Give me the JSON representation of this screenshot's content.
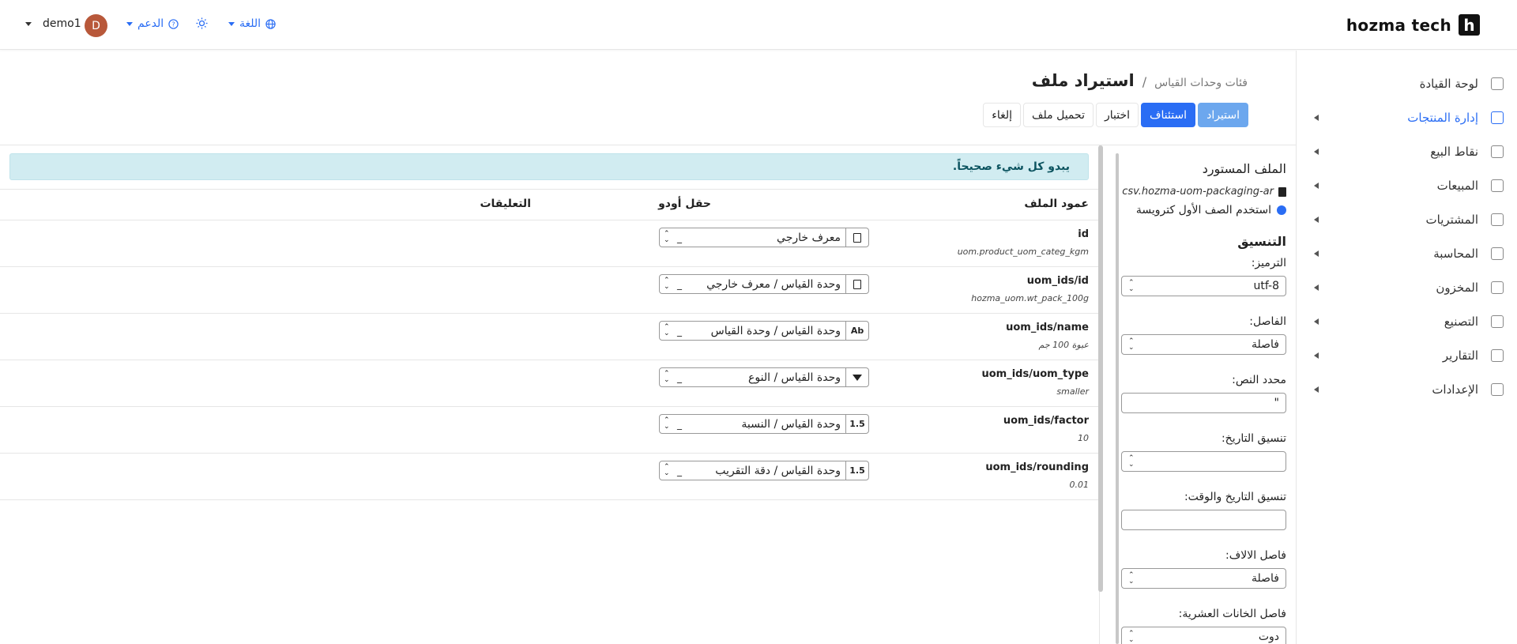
{
  "brand": {
    "name": "hozma tech",
    "mark": "h"
  },
  "topbar": {
    "user_name": "demo1",
    "avatar_letter": "D",
    "support_label": "الدعم",
    "language_label": "اللغة"
  },
  "sidebar": {
    "items": [
      {
        "label": "لوحة القيادة",
        "icon": "grid-icon",
        "has_caret": false,
        "active": false
      },
      {
        "label": "إدارة المنتجات",
        "icon": "tag-icon",
        "has_caret": true,
        "active": true
      },
      {
        "label": "نقاط البيع",
        "icon": "store-icon",
        "has_caret": true,
        "active": false
      },
      {
        "label": "المبيعات",
        "icon": "chart-icon",
        "has_caret": true,
        "active": false
      },
      {
        "label": "المشتريات",
        "icon": "wallet-icon",
        "has_caret": true,
        "active": false
      },
      {
        "label": "المحاسبة",
        "icon": "building-icon",
        "has_caret": true,
        "active": false
      },
      {
        "label": "المخزون",
        "icon": "box-icon",
        "has_caret": true,
        "active": false
      },
      {
        "label": "التصنيع",
        "icon": "document-icon",
        "has_caret": true,
        "active": false
      },
      {
        "label": "التقارير",
        "icon": "report-icon",
        "has_caret": true,
        "active": false
      },
      {
        "label": "الإعدادات",
        "icon": "gear-icon",
        "has_caret": true,
        "active": false
      }
    ]
  },
  "breadcrumb": {
    "parent": "فئات وحدات القياس",
    "separator": "/",
    "title": "استيراد ملف"
  },
  "actions": {
    "import": "استيراد",
    "resume": "استئناف",
    "test": "اختبار",
    "upload": "تحميل ملف",
    "cancel": "إلغاء"
  },
  "options": {
    "imported_file_title": "الملف المستورد",
    "file_name": "csv.hozma-uom-packaging-ar",
    "first_row_header": "استخدم الصف الأول كترويسة",
    "formatting_title": "التنسيق",
    "encoding_label": "الترميز:",
    "encoding_value": "utf-8",
    "separator_label": "الفاصل:",
    "separator_value": "فاصلة",
    "text_delimiter_label": "محدد النص:",
    "text_delimiter_value": "\"",
    "date_format_label": "تنسيق التاريخ:",
    "date_format_value": "",
    "datetime_format_label": "تنسيق التاريخ والوقت:",
    "datetime_format_value": "",
    "thousands_label": "فاصل الالاف:",
    "thousands_value": "فاصلة",
    "decimal_label": "فاصل الخانات العشرية:",
    "decimal_value": "دوت"
  },
  "mapping": {
    "alert": "يبدو كل شيء صحيحاً.",
    "headers": {
      "file_column": "عمود الملف",
      "odoo_field": "حقل أودو",
      "comments": "التعليقات"
    },
    "rows": [
      {
        "column": "id",
        "sample": "uom.product_uom_categ_kgm",
        "field": "معرف خارجي",
        "type": "doc",
        "dash": "_"
      },
      {
        "column": "uom_ids/id",
        "sample": "hozma_uom.wt_pack_100g",
        "field": "وحدة القياس / معرف خارجي",
        "type": "doc",
        "dash": "_"
      },
      {
        "column": "uom_ids/name",
        "sample": "عبوة 100 جم",
        "field": "وحدة القياس / وحدة القياس",
        "type": "Ab",
        "dash": "_"
      },
      {
        "column": "uom_ids/uom_type",
        "sample": "smaller",
        "field": "وحدة القياس / النوع",
        "type": "select",
        "dash": "_"
      },
      {
        "column": "uom_ids/factor",
        "sample": "10",
        "field": "وحدة القياس / النسبة",
        "type": "1.5",
        "dash": "_"
      },
      {
        "column": "uom_ids/rounding",
        "sample": "0.01",
        "field": "وحدة القياس / دقة التقريب",
        "type": "1.5",
        "dash": "_"
      }
    ]
  }
}
